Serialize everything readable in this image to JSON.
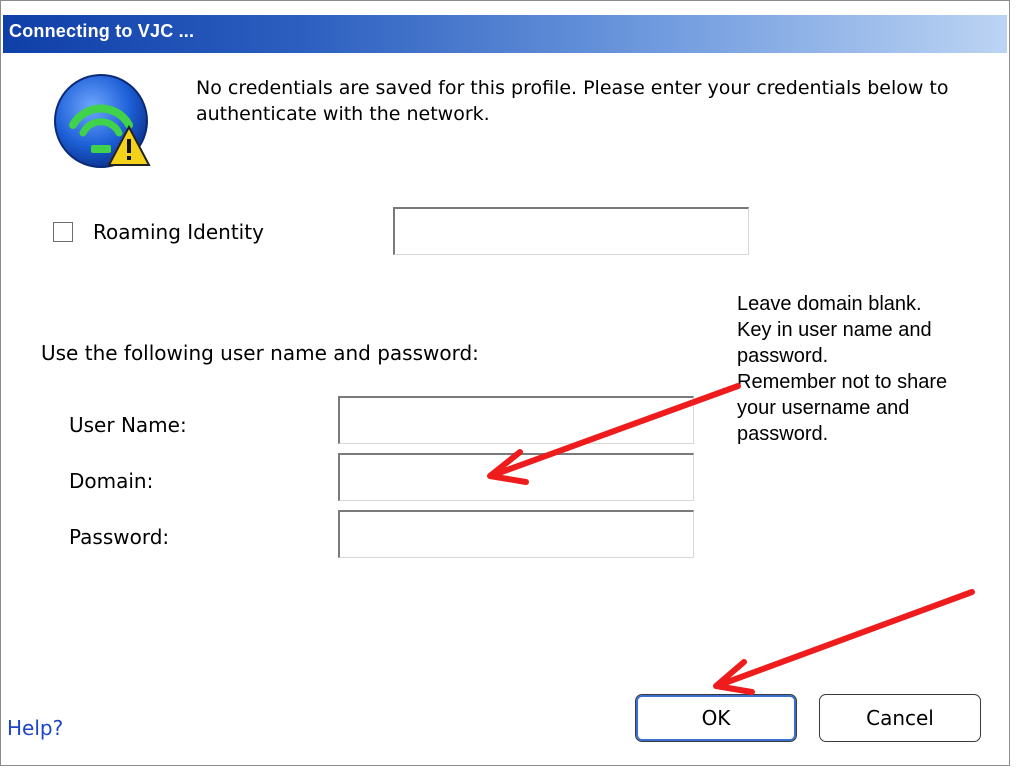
{
  "window": {
    "title": "Connecting to VJC ..."
  },
  "message": "No credentials are saved for this profile. Please enter your credentials below to authenticate with the network.",
  "roaming": {
    "label": "Roaming Identity",
    "checked": false,
    "value": ""
  },
  "credentials": {
    "instruction": "Use the following user name and password:",
    "username_label": "User Name:",
    "username_value": "",
    "domain_label": "Domain:",
    "domain_value": "",
    "password_label": "Password:",
    "password_value": ""
  },
  "annotation": {
    "lines": [
      "Leave domain blank.",
      "Key in user name and",
      "password.",
      "Remember not to share",
      "your username and",
      "password."
    ],
    "arrow_color": "#ee1c1c"
  },
  "buttons": {
    "ok_label": "OK",
    "cancel_label": "Cancel"
  },
  "help": {
    "label": "Help?"
  },
  "colors": {
    "title_gradient_start": "#0f3fa8",
    "title_gradient_end": "#bcd4f4",
    "link": "#1c45c9",
    "icon_blue": "#1d5fd6",
    "icon_green": "#3fd24a",
    "warning_yellow": "#f5d21a"
  },
  "icons": {
    "app": "wireless-network-warning-icon"
  }
}
